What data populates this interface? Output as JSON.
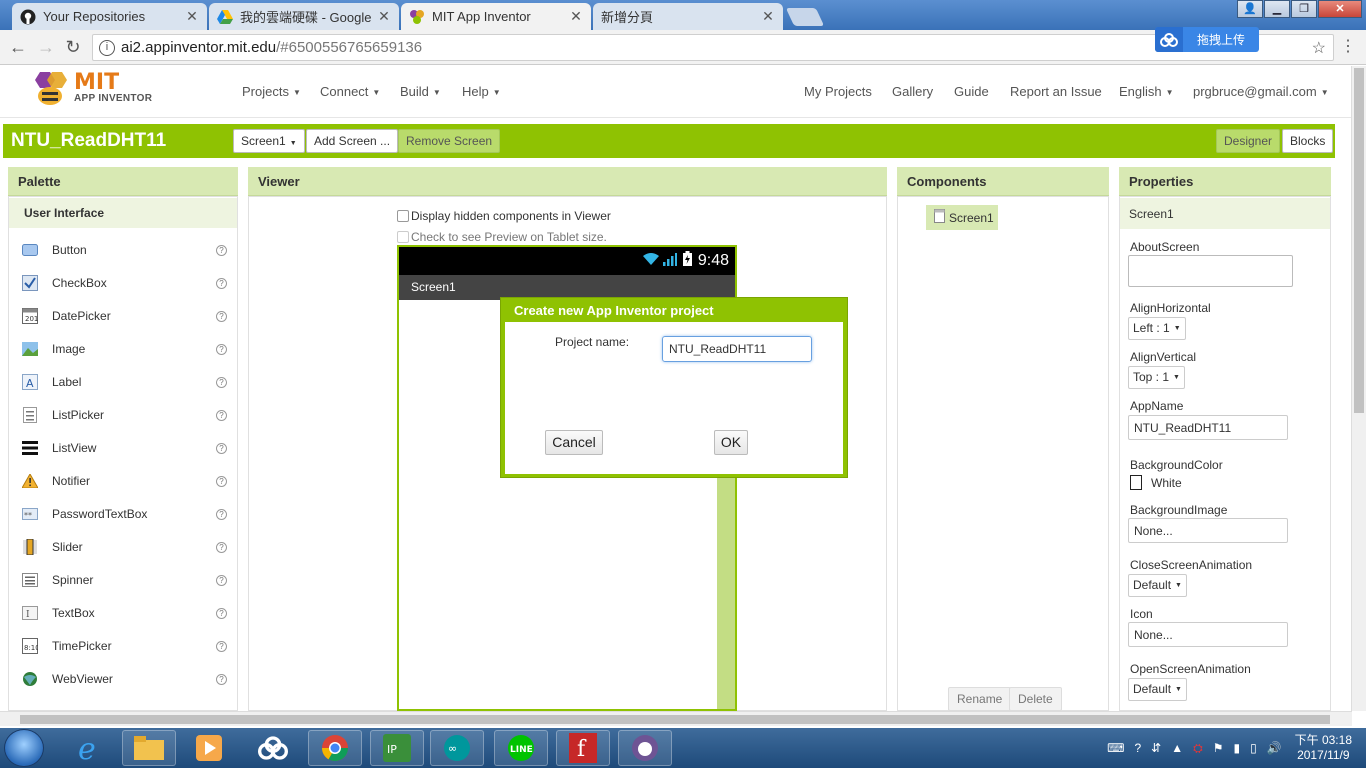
{
  "browser": {
    "tabs": [
      {
        "title": "Your Repositories",
        "icon": "github-icon",
        "active": false
      },
      {
        "title": "我的雲端硬碟 - Google",
        "icon": "google-drive-icon",
        "active": false
      },
      {
        "title": "MIT App Inventor",
        "icon": "app-inventor-icon",
        "active": true
      },
      {
        "title": "新增分頁",
        "icon": "",
        "active": false
      }
    ],
    "address": {
      "host": "ai2.appinventor.mit.edu",
      "path": "/#6500556765659136"
    },
    "upload_widget_label": "拖拽上传"
  },
  "header": {
    "logo_line1": "MIT",
    "logo_line2": "APP INVENTOR",
    "left_menu": [
      "Projects",
      "Connect",
      "Build",
      "Help"
    ],
    "right_links": [
      "My Projects",
      "Gallery",
      "Guide",
      "Report an Issue"
    ],
    "language": "English",
    "account": "prgbruce@gmail.com"
  },
  "project_bar": {
    "project_name": "NTU_ReadDHT11",
    "screen_select": "Screen1",
    "add_screen": "Add Screen ...",
    "remove_screen": "Remove Screen",
    "designer": "Designer",
    "blocks": "Blocks"
  },
  "palette": {
    "title": "Palette",
    "section": "User Interface",
    "items": [
      "Button",
      "CheckBox",
      "DatePicker",
      "Image",
      "Label",
      "ListPicker",
      "ListView",
      "Notifier",
      "PasswordTextBox",
      "Slider",
      "Spinner",
      "TextBox",
      "TimePicker",
      "WebViewer"
    ],
    "help_glyph": "?"
  },
  "viewer": {
    "title": "Viewer",
    "display_hidden": "Display hidden components in Viewer",
    "tablet_preview": "Check to see Preview on Tablet size.",
    "phone_time": "9:48",
    "screen_title": "Screen1"
  },
  "dialog": {
    "title": "Create new App Inventor project",
    "project_name_label": "Project name:",
    "project_name_value": "NTU_ReadDHT11",
    "cancel": "Cancel",
    "ok": "OK"
  },
  "components": {
    "title": "Components",
    "tree_root": "Screen1",
    "rename": "Rename",
    "delete": "Delete"
  },
  "properties": {
    "title": "Properties",
    "component": "Screen1",
    "about_screen_label": "AboutScreen",
    "align_horizontal_label": "AlignHorizontal",
    "align_horizontal_value": "Left : 1",
    "align_vertical_label": "AlignVertical",
    "align_vertical_value": "Top : 1",
    "app_name_label": "AppName",
    "app_name_value": "NTU_ReadDHT11",
    "background_color_label": "BackgroundColor",
    "background_color_value": "White",
    "background_image_label": "BackgroundImage",
    "background_image_value": "None...",
    "close_anim_label": "CloseScreenAnimation",
    "close_anim_value": "Default",
    "icon_label": "Icon",
    "icon_value": "None...",
    "open_anim_label": "OpenScreenAnimation",
    "open_anim_value": "Default"
  },
  "taskbar": {
    "clock_ampm_time": "下午 03:18",
    "clock_date": "2017/11/9"
  },
  "colors": {
    "accent_green": "#8fc202",
    "panel_header": "#d8e9b3",
    "logo_orange": "#e57a18"
  }
}
